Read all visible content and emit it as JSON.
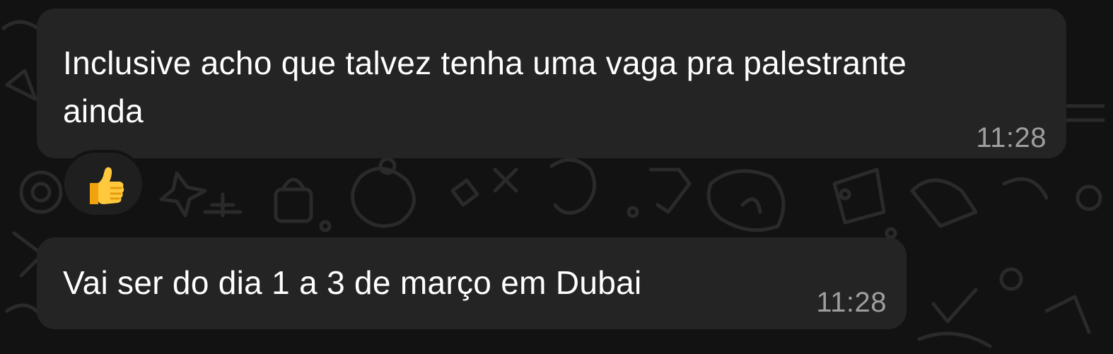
{
  "conversation": {
    "messages": [
      {
        "text": "Inclusive acho que talvez tenha uma vaga pra palestrante ainda",
        "time": "11:28",
        "reaction": {
          "emoji": "👍",
          "icon": "thumbs-up-icon"
        }
      },
      {
        "text": "Vai ser do dia 1 a 3 de março em Dubai",
        "time": "11:28"
      }
    ]
  },
  "colors": {
    "background": "#121212",
    "bubble": "#242424",
    "text": "#ffffff",
    "timestamp": "#9e9e9e"
  }
}
